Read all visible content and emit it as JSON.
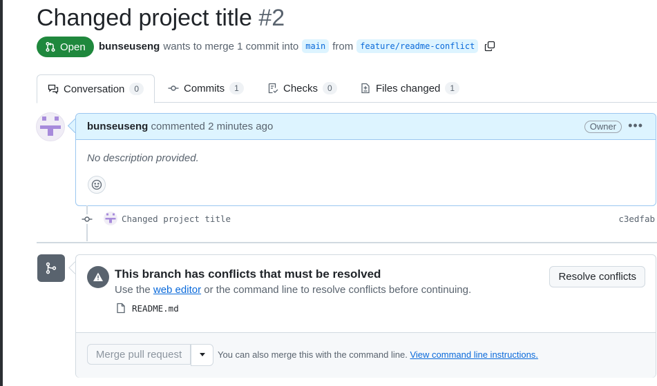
{
  "pr": {
    "title": "Changed project title",
    "number": "#2",
    "state": "Open",
    "author": "bunseuseng",
    "merge_text": "wants to merge 1 commit into",
    "base_branch": "main",
    "from_text": "from",
    "head_branch": "feature/readme-conflict"
  },
  "tabs": [
    {
      "label": "Conversation",
      "count": "0",
      "icon": "comment-discussion-icon"
    },
    {
      "label": "Commits",
      "count": "1",
      "icon": "git-commit-icon"
    },
    {
      "label": "Checks",
      "count": "0",
      "icon": "checklist-icon"
    },
    {
      "label": "Files changed",
      "count": "1",
      "icon": "file-diff-icon"
    }
  ],
  "comment": {
    "author": "bunseuseng",
    "action": "commented",
    "time": "2 minutes ago",
    "badge": "Owner",
    "menu": "•••",
    "body": "No description provided."
  },
  "commit": {
    "message": "Changed project title",
    "sha": "c3edfab"
  },
  "merge": {
    "conflict_title": "This branch has conflicts that must be resolved",
    "desc_prefix": "Use the",
    "desc_link": "web editor",
    "desc_suffix": "or the command line to resolve conflicts before continuing.",
    "file": "README.md",
    "resolve_button": "Resolve conflicts",
    "merge_button": "Merge pull request",
    "note": "You can also merge this with the command line.",
    "note_link": "View command line instructions."
  },
  "colors": {
    "open_green": "#1f883d",
    "link_blue": "#0969da",
    "comment_header_bg": "#ddf4ff",
    "avatar_purple": "#a78bdb"
  }
}
